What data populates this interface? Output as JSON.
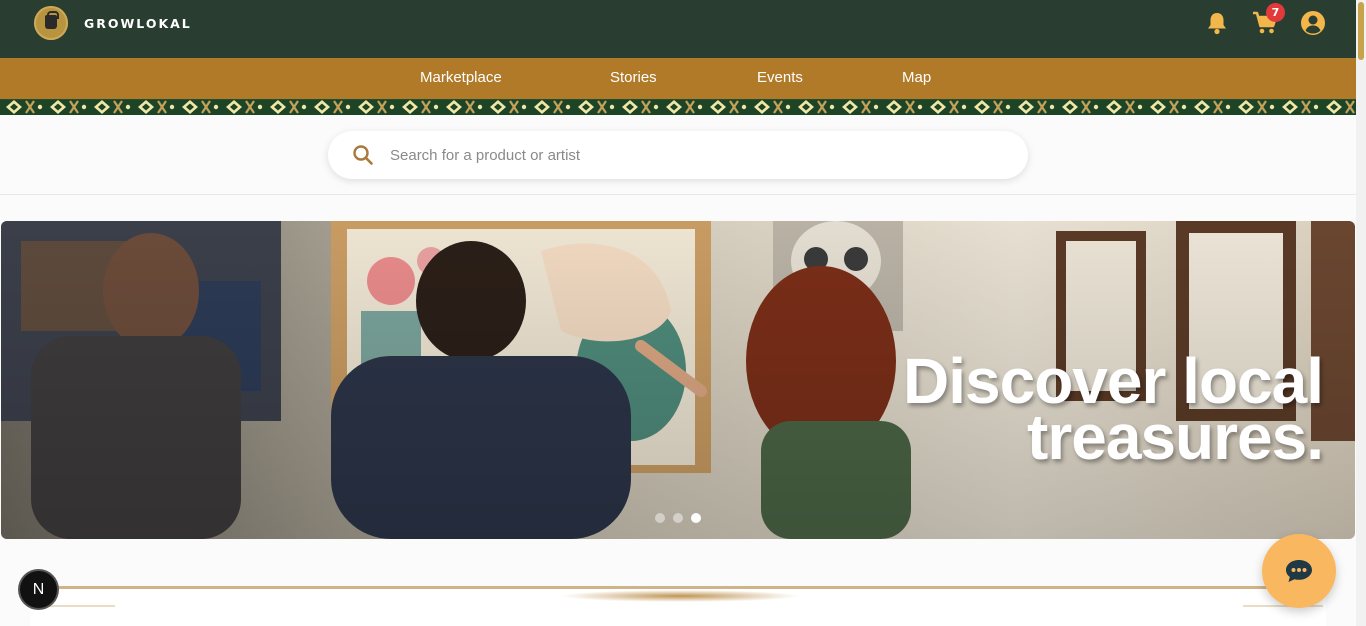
{
  "header": {
    "brand_name": "GROWLOKAL",
    "logo_icon": "shopping-bag-logo-icon",
    "bell_icon": "bell-icon",
    "cart_icon": "cart-icon",
    "cart_count": "7",
    "account_icon": "user-circle-icon"
  },
  "nav": {
    "items": [
      {
        "label": "Marketplace"
      },
      {
        "label": "Stories"
      },
      {
        "label": "Events"
      },
      {
        "label": "Map"
      }
    ]
  },
  "search": {
    "placeholder": "Search for a product or artist",
    "value": ""
  },
  "hero": {
    "title_line1": "Discover local",
    "title_line2": "treasures.",
    "slide_count": 3,
    "active_slide": 3
  },
  "floating": {
    "next_badge": "N",
    "chat_icon": "chat-bubble-icon"
  },
  "colors": {
    "header_bg": "#2a3d31",
    "nav_bg": "#b07a28",
    "accent_gold": "#f2b64a",
    "badge_red": "#e23a3a",
    "chat_fab": "#f9b860"
  }
}
